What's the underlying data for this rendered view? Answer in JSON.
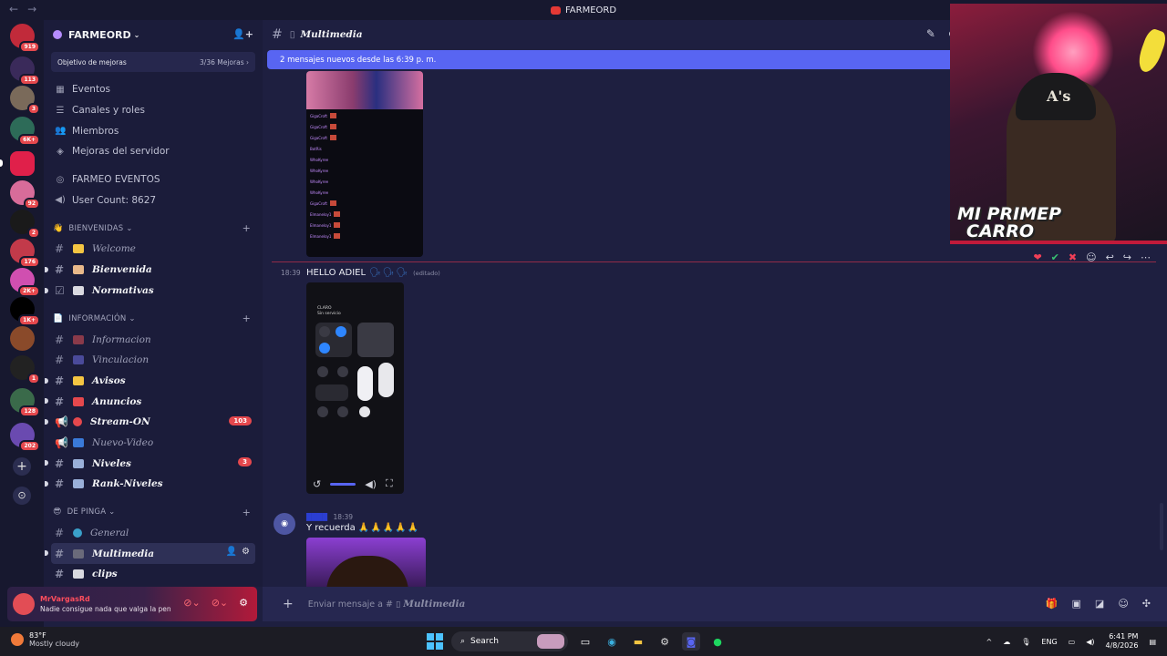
{
  "window": {
    "title": "FARMEORD",
    "back": "←",
    "forward": "→"
  },
  "rail": {
    "badges": [
      "919",
      "113",
      "3",
      "6K+",
      "92",
      "2",
      "176",
      "2K+",
      "1K+",
      "1",
      "128",
      "202"
    ],
    "add": "+",
    "explore": "⊙"
  },
  "server": {
    "name": "FARMEORD",
    "chevron": "⌄",
    "boost_goal": "Objetivo de mejoras",
    "boost_progress": "3/36 Mejoras",
    "boost_arrow": "›"
  },
  "menu": [
    {
      "icon": "calendar-icon",
      "glyph": "▦",
      "label": "Eventos"
    },
    {
      "icon": "channels-icon",
      "glyph": "☰",
      "label": "Canales y roles"
    },
    {
      "icon": "members-icon",
      "glyph": "👥",
      "label": "Miembros"
    },
    {
      "icon": "boost-icon",
      "glyph": "◈",
      "label": "Mejoras del servidor"
    }
  ],
  "stats": [
    {
      "icon": "broadcast-icon",
      "glyph": "◎",
      "label": "FARMEO EVENTOS"
    },
    {
      "icon": "speaker-icon",
      "glyph": "◀)",
      "label": "User Count: 8627"
    }
  ],
  "categories": {
    "bienvenidas": "BIENVENIDAS",
    "informacion": "INFORMACIÓN",
    "depinga": "DE PINGA"
  },
  "channels": {
    "welcome": "Welcome",
    "bienvenida": "Bienvenida",
    "normativas": "Normativas",
    "informacion": "Informacion",
    "vinculacion": "Vinculacion",
    "avisos": "Avisos",
    "anuncios": "Anuncios",
    "stream_on": "Stream-ON",
    "stream_on_badge": "103",
    "nuevo_video": "Nuevo-Video",
    "niveles": "Niveles",
    "niveles_badge": "3",
    "rank_niveles": "Rank-Niveles",
    "general": "General",
    "multimedia": "Multimedia",
    "clips": "clips"
  },
  "user": {
    "name": "MrVargasRd",
    "status": "Nadie consigue nada que valga la pen"
  },
  "chat": {
    "channel_title": "Multimedia",
    "new_messages": "2 mensajes nuevos desde las 6:39 p. m.",
    "msg1_time": "18:39",
    "msg1_text": "HELLO ADIEL",
    "msg1_emoji": "🗣🗣🗣",
    "msg1_edited": "(editado)",
    "phone_carrier": "CLARO",
    "phone_service": "Sin servicio",
    "msg2_time": "18:39",
    "msg2_text": "Y recuerda",
    "msg2_emoji": "🙏🙏🙏🙏🙏",
    "composer_prefix": "Enviar mensaje a #",
    "composer_channel": "Multimedia"
  },
  "overlay": {
    "caption_line1": "MI PRIMEP",
    "caption_line2": "CARRO",
    "hat_logo": "A's"
  },
  "taskbar": {
    "temp": "83°F",
    "weather": "Mostly cloudy",
    "search": "Search",
    "lang": "ENG",
    "time": "6:41 PM",
    "date": "4/8/2026"
  },
  "colors": {
    "accent": "#5865f2",
    "badge": "#e5484d",
    "unread_bar": "#5865f2"
  }
}
